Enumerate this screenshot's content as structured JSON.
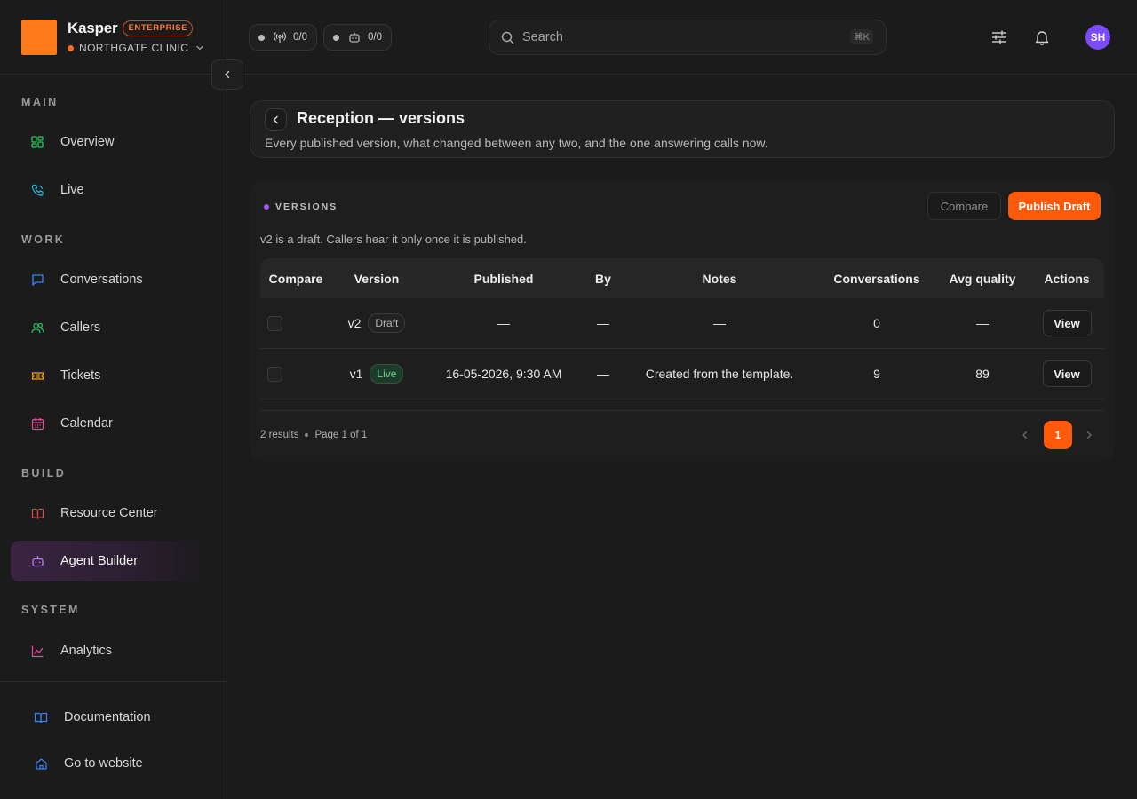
{
  "brand": {
    "name": "Kasper",
    "tier": "ENTERPRISE",
    "org": "NORTHGATE CLINIC",
    "logo_color": "#ff7a1a"
  },
  "sidebar": {
    "sections": {
      "main": "MAIN",
      "work": "WORK",
      "build": "BUILD",
      "system": "SYSTEM"
    },
    "items": [
      {
        "label": "Overview",
        "icon": "grid-icon"
      },
      {
        "label": "Live",
        "icon": "phone-icon"
      },
      {
        "label": "Conversations",
        "icon": "chat-icon"
      },
      {
        "label": "Callers",
        "icon": "users-icon"
      },
      {
        "label": "Tickets",
        "icon": "ticket-icon"
      },
      {
        "label": "Calendar",
        "icon": "calendar-icon"
      },
      {
        "label": "Resource Center",
        "icon": "book-icon"
      },
      {
        "label": "Agent Builder",
        "icon": "bot-icon",
        "active": true
      },
      {
        "label": "Analytics",
        "icon": "chart-icon"
      }
    ],
    "footer": [
      {
        "label": "Documentation",
        "icon": "book-open-icon"
      },
      {
        "label": "Go to website",
        "icon": "home-icon"
      }
    ]
  },
  "header": {
    "status_pills": [
      {
        "icon": "antenna-icon",
        "value": "0/0"
      },
      {
        "icon": "bot-icon",
        "value": "0/0"
      }
    ],
    "search": {
      "placeholder": "Search",
      "shortcut": "⌘K"
    },
    "avatar_initials": "SH",
    "avatar_color": "#7b4bff"
  },
  "page": {
    "title": "Reception — versions",
    "subtitle": "Every published version, what changed between any two, and the one answering calls now."
  },
  "versions": {
    "section_title": "VERSIONS",
    "compare_label": "Compare",
    "publish_label": "Publish Draft",
    "draft_note": "v2 is a draft. Callers hear it only once it is published.",
    "columns": [
      "Compare",
      "Version",
      "Published",
      "By",
      "Notes",
      "Conversations",
      "Avg quality",
      "Actions"
    ],
    "rows": [
      {
        "version": "v2",
        "status": "Draft",
        "published": "—",
        "by": "—",
        "notes": "—",
        "conversations": "0",
        "avg_quality": "—",
        "action": "View"
      },
      {
        "version": "v1",
        "status": "Live",
        "published": "16-05-2026, 9:30 AM",
        "by": "—",
        "notes": "Created from the template.",
        "conversations": "9",
        "avg_quality": "89",
        "action": "View"
      }
    ],
    "results": "2 results",
    "page_info": "Page 1 of 1",
    "current_page": "1"
  },
  "colors": {
    "accent": "#ff5a0a",
    "section_dot": "#a855f7",
    "live_green": "#5fd38d"
  }
}
